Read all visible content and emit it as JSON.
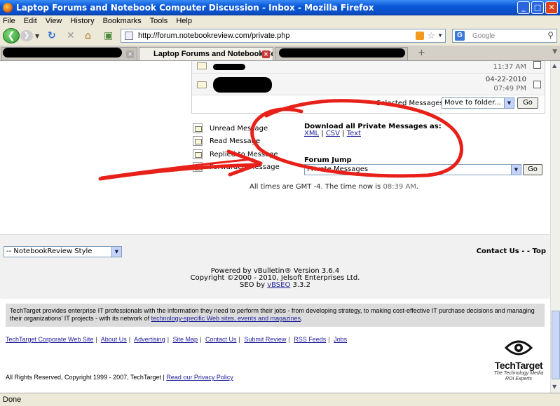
{
  "window": {
    "title": "Laptop Forums and Notebook Computer Discussion - Inbox - Mozilla Firefox",
    "controls": [
      "_",
      "□",
      "✕"
    ]
  },
  "menu": [
    "File",
    "Edit",
    "View",
    "History",
    "Bookmarks",
    "Tools",
    "Help"
  ],
  "nav": {
    "url": "http://forum.notebookreview.com/private.php",
    "search_placeholder": "Google"
  },
  "tabs": {
    "active_label": "Laptop Forums and Notebook Co...",
    "new_tab": "+"
  },
  "messages": [
    {
      "time": "11:37 AM"
    },
    {
      "date": "04-22-2010",
      "time": "07:49 PM"
    }
  ],
  "selected_messages": {
    "label": "Selected Messages:",
    "select_value": "Move to folder...",
    "go": "Go"
  },
  "legend": [
    "Unread Message",
    "Read Message",
    "Replied-to Message",
    "Forwarded Message"
  ],
  "download": {
    "title": "Download all Private Messages as:",
    "links": [
      "XML",
      "CSV",
      "Text"
    ]
  },
  "forum_jump": {
    "title": "Forum Jump",
    "value": "Private Messages",
    "go": "Go"
  },
  "time_line": {
    "prefix": "All times are GMT -4. The time now is",
    "time": "08:39 AM",
    "suffix": "."
  },
  "footer": {
    "style_select": "-- NotebookReview Style",
    "contact": "Contact Us - - Top",
    "powered_by": "Powered by vBulletin® Version 3.6.4",
    "copyright": "Copyright ©2000 - 2010, Jelsoft Enterprises Ltd.",
    "seo_prefix": "SEO by",
    "seo_link": "vBSEO",
    "seo_version": "3.3.2"
  },
  "techtarget": {
    "blurb": "TechTarget provides enterprise IT professionals with the information they need to perform their jobs - from developing strategy, to making cost-effective IT purchase decisions and managing their organizations' IT projects - with its network of",
    "blurb_link": "technology-specific Web sites, events and magazines",
    "blurb_end": ".",
    "links": [
      "TechTarget Corporate Web Site",
      "About Us",
      "Advertising",
      "Site Map",
      "Contact Us",
      "Submit Review",
      "RSS Feeds",
      "Jobs"
    ],
    "copyright": "All Rights Reserved, Copyright 1999 - 2007, TechTarget |",
    "privacy": "Read our Privacy Policy",
    "logo_brand": "TechTarget",
    "logo_tag_1": "The Technology Media",
    "logo_tag_2": "ROI Experts"
  },
  "status": "Done",
  "colors": {
    "annotation_red": "#e8201a",
    "titlebar_blue": "#0a58d8",
    "link_blue": "#22229c"
  }
}
